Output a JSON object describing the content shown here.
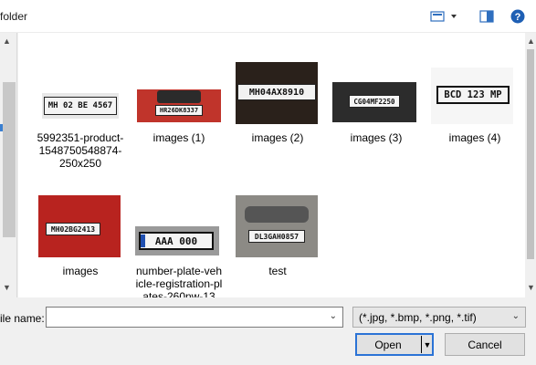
{
  "toolbar": {
    "title_fragment": "folder",
    "view_icon": "change-view-icon",
    "pane_icon": "preview-pane-icon",
    "help_icon": "help-icon"
  },
  "files": [
    {
      "caption": "5992351-product-1548750548874-250x250",
      "plate_text": "MH 02 BE 4567"
    },
    {
      "caption": "images (1)",
      "plate_text": "HR26DK8337"
    },
    {
      "caption": "images (2)",
      "plate_text": "MH04AX8910"
    },
    {
      "caption": "images (3)",
      "plate_text": "CG04MF2250"
    },
    {
      "caption": "images (4)",
      "plate_text": "BCD 123 MP"
    },
    {
      "caption": "images",
      "plate_text": "MH02BG2413"
    },
    {
      "caption": "number-plate-vehicle-registration-plates-260nw-13",
      "plate_text": "AAA 000"
    },
    {
      "caption": "test",
      "plate_text": "DL3GAH0857"
    }
  ],
  "bottom": {
    "file_name_label": "ile name:",
    "file_name_value": "",
    "filter_text": "(*.jpg, *.bmp, *.png, *.tif)",
    "open_label": "Open",
    "cancel_label": "Cancel"
  }
}
